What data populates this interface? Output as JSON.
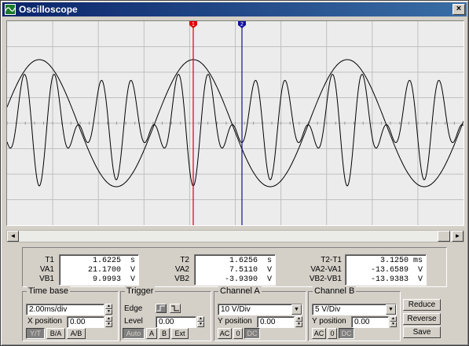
{
  "window": {
    "title": "Oscilloscope",
    "close_glyph": "×"
  },
  "colors": {
    "cursor1": "#e00000",
    "cursor2": "#1010a0",
    "trace": "#000000",
    "grid": "#c0c0c0",
    "screen_bg": "#ececec"
  },
  "cursors": {
    "t1_label": "1",
    "t2_label": "2"
  },
  "scrollbar": {
    "left_arrow": "◄",
    "right_arrow": "►"
  },
  "readout": {
    "group1": {
      "labels": [
        "T1",
        "VA1",
        "VB1"
      ],
      "values": [
        "1.6225",
        "21.1700",
        "9.9993"
      ],
      "units": [
        "s",
        "V",
        "V"
      ]
    },
    "group2": {
      "labels": [
        "T2",
        "VA2",
        "VB2"
      ],
      "values": [
        "1.6256",
        "7.5110",
        "-3.9390"
      ],
      "units": [
        "s",
        "V",
        "V"
      ]
    },
    "group3": {
      "labels": [
        "T2-T1",
        "VA2-VA1",
        "VB2-VB1"
      ],
      "values": [
        "3.1250",
        "-13.6589",
        "-13.9383"
      ],
      "units": [
        "ms",
        "V",
        "V"
      ]
    }
  },
  "timebase": {
    "title": "Time base",
    "value": "2.00ms/div",
    "xpos_label": "X position",
    "xpos_value": "0.00",
    "modes": [
      "Y/T",
      "B/A",
      "A/B"
    ]
  },
  "trigger": {
    "title": "Trigger",
    "edge_label": "Edge",
    "level_label": "Level",
    "level_value": "0.00",
    "buttons": [
      "Auto",
      "A",
      "B",
      "Ext"
    ]
  },
  "channel_a": {
    "title": "Channel A",
    "value": "10 V/Div",
    "ypos_label": "Y position",
    "ypos_value": "0.00",
    "coupling": [
      "AC",
      "0",
      "DC"
    ]
  },
  "channel_b": {
    "title": "Channel B",
    "value": "5 V/Div",
    "ypos_label": "Y position",
    "ypos_value": "0.00",
    "coupling": [
      "AC",
      "0",
      "DC"
    ]
  },
  "actions": {
    "reduce": "Reduce",
    "reverse": "Reverse",
    "save": "Save"
  }
}
